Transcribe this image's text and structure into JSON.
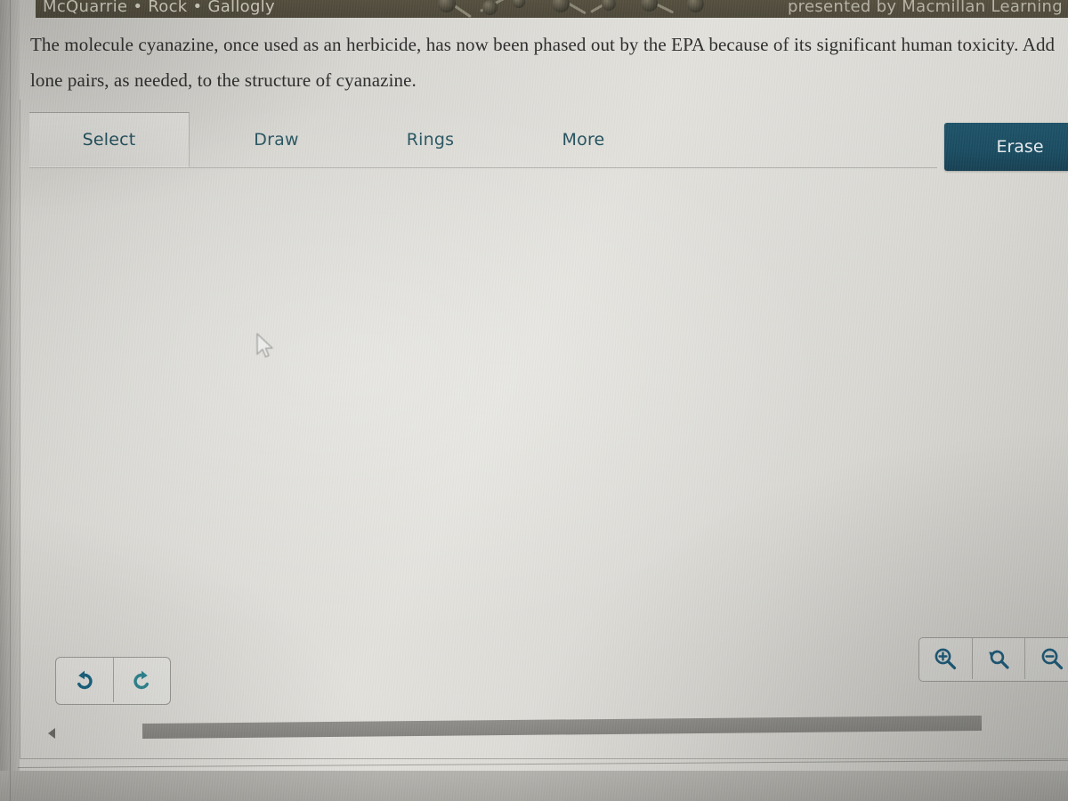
{
  "banner": {
    "authors": "McQuarrie • Rock • Gallogly",
    "presented_by": "presented by Macmillan Learning",
    "art_name": "molecule-ball-and-stick-art"
  },
  "question": {
    "text": "The molecule cyanazine, once used as an herbicide, has now been phased out by the EPA because of its significant human toxicity. Add lone pairs, as needed, to the structure of cyanazine."
  },
  "toolbar": {
    "tabs": [
      {
        "label": "Select",
        "active": true
      },
      {
        "label": "Draw",
        "active": false
      },
      {
        "label": "Rings",
        "active": false
      },
      {
        "label": "More",
        "active": false
      }
    ],
    "erase_label": "Erase",
    "erase_color": "#1a4d62",
    "tab_text_color": "#1f4e5a"
  },
  "history_controls": {
    "undo": {
      "name": "undo-button",
      "icon": "undo-arrow-icon",
      "color": "#15617f"
    },
    "redo": {
      "name": "redo-button",
      "icon": "redo-arrow-icon",
      "color": "#2a8590"
    }
  },
  "zoom_controls": {
    "zoom_in": {
      "name": "zoom-in-button",
      "icon": "magnifier-plus-icon"
    },
    "zoom_reset": {
      "name": "zoom-reset-button",
      "icon": "magnifier-reset-icon"
    },
    "zoom_out": {
      "name": "zoom-out-button",
      "icon": "magnifier-minus-icon"
    },
    "icon_color": "#1b5a79"
  },
  "scrollbar": {
    "orientation": "horizontal",
    "left_arrow_icon": "caret-left-icon",
    "thumb_color": "#8a8985"
  },
  "canvas": {
    "cursor_icon": "mouse-pointer-cursor",
    "content": ""
  }
}
